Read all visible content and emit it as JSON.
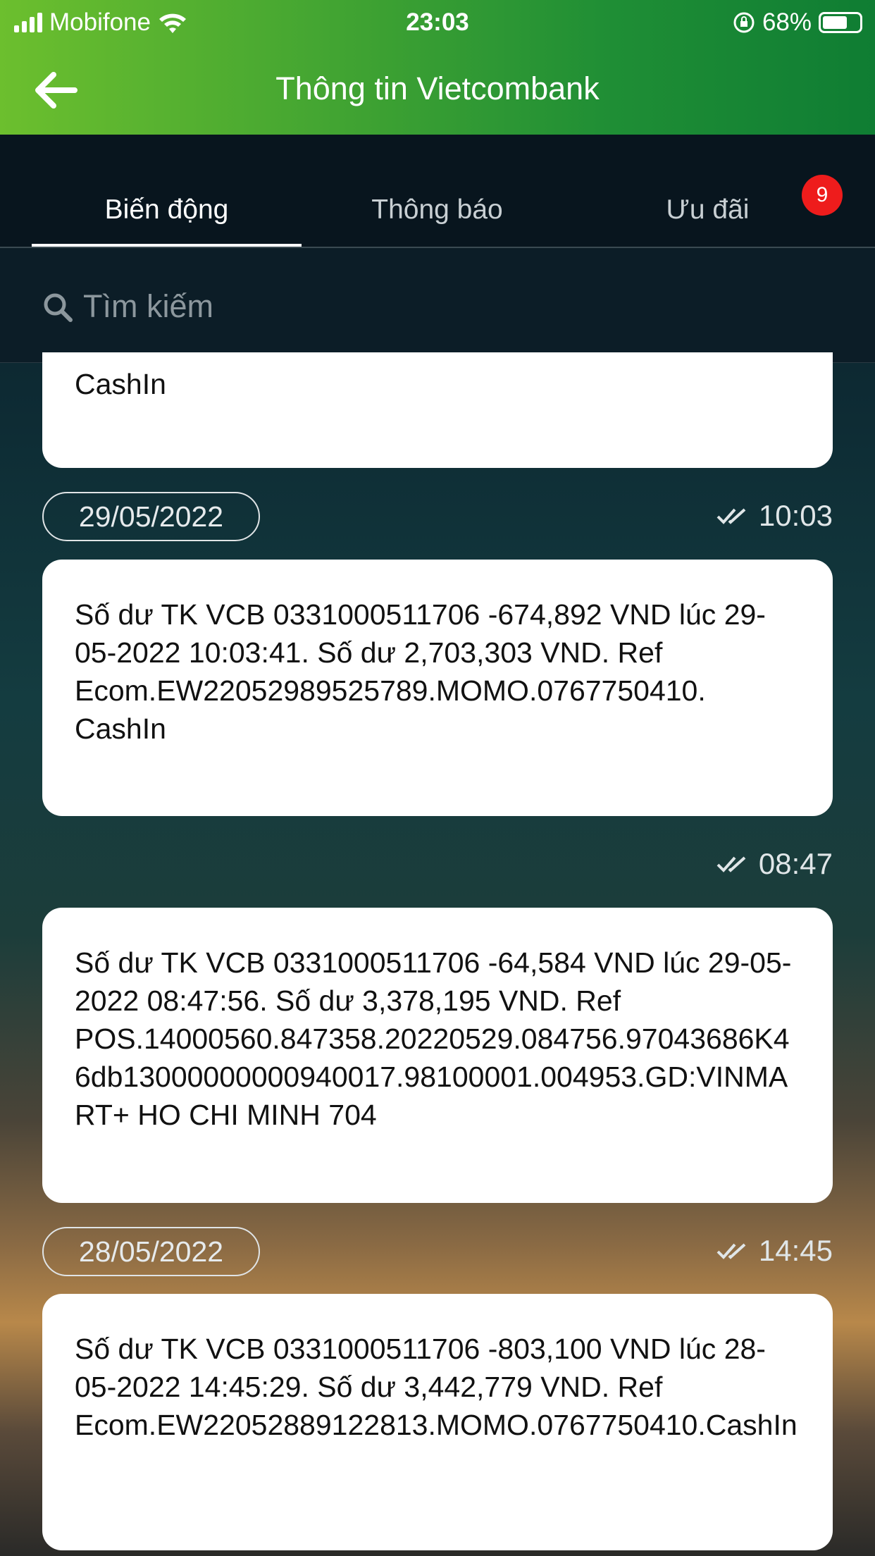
{
  "status_bar": {
    "carrier": "Mobifone",
    "time": "23:03",
    "battery": "68%",
    "battery_level": 0.68
  },
  "header": {
    "title": "Thông tin Vietcombank",
    "back_icon": "arrow-left-icon"
  },
  "tabs": [
    {
      "label": "Biến động",
      "active": true
    },
    {
      "label": "Thông báo"
    },
    {
      "label": "Ưu đãi",
      "badge": "9"
    }
  ],
  "search": {
    "placeholder": "Tìm kiếm"
  },
  "messages": [
    {
      "text": "CashIn"
    },
    {
      "date": "29/05/2022",
      "time": "10:03",
      "text": "Số dư TK VCB 0331000511706 -674,892 VND lúc 29-05-2022 10:03:41. Số dư 2,703,303 VND. Ref Ecom.EW22052989525789.MOMO.0767750410. CashIn"
    },
    {
      "time": "08:47",
      "text": "Số dư TK VCB 0331000511706 -64,584 VND lúc 29-05-2022 08:47:56. Số dư 3,378,195 VND. Ref POS.14000560.847358.20220529.084756.97043686K46db13000000000940017.98100001.004953.GD:VINMART+ HO CHI MINH 704"
    },
    {
      "date": "28/05/2022",
      "time": "14:45",
      "text": "Số dư TK VCB 0331000511706 -803,100 VND lúc 28-05-2022 14:45:29. Số dư 3,442,779 VND. Ref Ecom.EW22052889122813.MOMO.0767750410.CashIn"
    }
  ],
  "colors": {
    "header_start": "#6cbf2e",
    "header_end": "#0f7d33",
    "badge": "#ee1c1c"
  }
}
